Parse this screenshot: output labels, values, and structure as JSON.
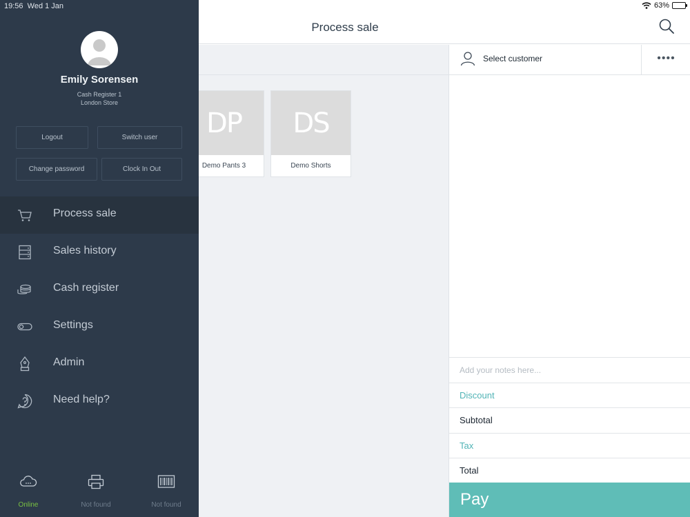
{
  "status_bar": {
    "time": "19:56",
    "date": "Wed 1 Jan",
    "battery": "63%",
    "battery_level": 0.63
  },
  "header": {
    "title": "Process sale"
  },
  "products": [
    {
      "initials": "DP",
      "name": "Demo Pants 3"
    },
    {
      "initials": "DS",
      "name": "Demo Shorts"
    }
  ],
  "cart": {
    "customer_label": "Select customer",
    "more_label": "••••",
    "notes_placeholder": "Add your notes here...",
    "discount_label": "Discount",
    "subtotal_label": "Subtotal",
    "tax_label": "Tax",
    "total_label": "Total",
    "pay_label": "Pay"
  },
  "sidebar": {
    "user_name": "Emily Sorensen",
    "register": "Cash Register 1",
    "store": "London Store",
    "buttons": {
      "logout": "Logout",
      "switch_user": "Switch user",
      "change_password": "Change password",
      "clock_in_out": "Clock In Out"
    },
    "nav": [
      {
        "label": "Process sale",
        "icon": "cart-icon"
      },
      {
        "label": "Sales history",
        "icon": "history-icon"
      },
      {
        "label": "Cash register",
        "icon": "coins-icon"
      },
      {
        "label": "Settings",
        "icon": "toggle-icon"
      },
      {
        "label": "Admin",
        "icon": "pen-icon"
      },
      {
        "label": "Need help?",
        "icon": "help-icon"
      }
    ],
    "footer": [
      {
        "label": "Online",
        "icon": "cloud-icon",
        "color": "#7ac142"
      },
      {
        "label": "Not found",
        "icon": "printer-icon",
        "color": "#6f7d8c"
      },
      {
        "label": "Not found",
        "icon": "barcode-icon",
        "color": "#6f7d8c"
      }
    ]
  },
  "colors": {
    "sidebar_bg": "#2d3a4a",
    "sidebar_active": "#28333f",
    "accent_teal": "#5fbdb7",
    "link_teal": "#4fb3b5",
    "online_green": "#7ac142"
  }
}
